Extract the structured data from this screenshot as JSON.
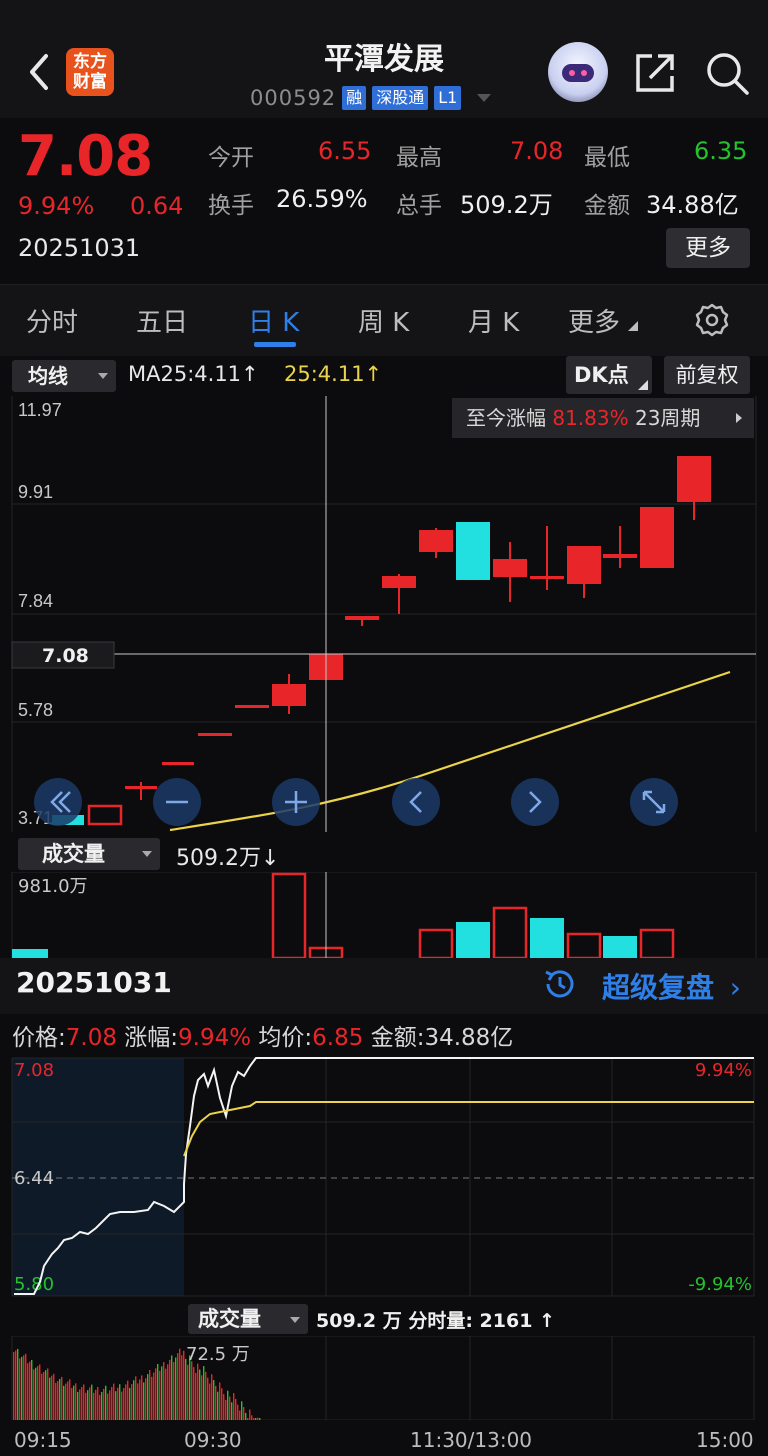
{
  "header": {
    "logo_text": "东方\n财富",
    "title": "平潭发展",
    "code": "000592",
    "tags": [
      "融",
      "深股通",
      "L1"
    ]
  },
  "quote": {
    "price": "7.08",
    "pct": "9.94%",
    "change": "0.64",
    "date": "20251031",
    "open_label": "今开",
    "open": "6.55",
    "high_label": "最高",
    "high": "7.08",
    "low_label": "最低",
    "low": "6.35",
    "turnover_label": "换手",
    "turnover": "26.59%",
    "volume_label": "总手",
    "volume": "509.2万",
    "amount_label": "金额",
    "amount": "34.88亿",
    "more": "更多"
  },
  "tabs": [
    {
      "label": "分时",
      "active": false
    },
    {
      "label": "五日",
      "active": false
    },
    {
      "label": "日 K",
      "active": true
    },
    {
      "label": "周 K",
      "active": false
    },
    {
      "label": "月 K",
      "active": false
    },
    {
      "label": "更多",
      "active": false
    }
  ],
  "ma_row": {
    "select": "均线",
    "ma_text": "MA25:4.11↑",
    "ma_value": "25:4.11↑",
    "dk": "DK点",
    "fq": "前复权"
  },
  "kline": {
    "since_label": "至今涨幅",
    "since_pct": "81.83%",
    "since_period": "23周期",
    "y_labels": [
      "11.97",
      "9.91",
      "7.84",
      "5.78",
      "3.71"
    ],
    "crosshair_label": "7.08",
    "colors": {
      "up": "#e8262a",
      "down": "#22e0e0",
      "ma": "#ecd44a"
    }
  },
  "volume": {
    "select": "成交量",
    "text": "509.2万↓",
    "max_label": "981.0万"
  },
  "replay": {
    "date": "20251031",
    "link": "超级复盘"
  },
  "intraday": {
    "price_label": "价格:",
    "price": "7.08",
    "pct_label": "涨幅:",
    "pct": "9.94%",
    "avg_label": "均价:",
    "avg": "6.85",
    "amount_label": "金额:",
    "amount": "34.88亿",
    "y_top": "7.08",
    "y_mid": "6.44",
    "y_bot": "5.80",
    "pct_top": "9.94%",
    "pct_bot": "-9.94%",
    "vol_select": "成交量",
    "vol_text": "509.2 万  分时量: 2161 ↑",
    "vol_max": "72.5 万",
    "times": [
      "09:15",
      "09:30",
      "11:30/13:00",
      "15:00"
    ]
  }
}
